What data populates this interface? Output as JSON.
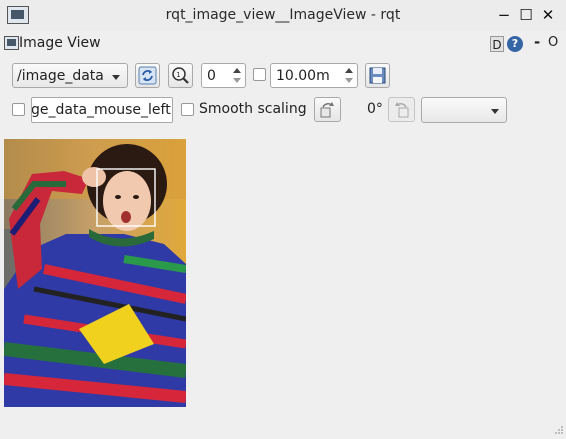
{
  "window": {
    "title": "rqt_image_view__ImageView - rqt",
    "minimize_glyph": "−",
    "maximize_glyph": "☐",
    "close_glyph": "✕"
  },
  "plugin": {
    "title": "Image View",
    "d_label": "D",
    "help_glyph": "?",
    "dash_label": "-",
    "o_label": "O"
  },
  "toolbar": {
    "topic_value": "/image_data",
    "zoom_value": "0",
    "duration_value": "10.00m",
    "mouse_topic_value": "ge_data_mouse_left",
    "smooth_scaling_label": "Smooth scaling",
    "rotation_value": "0°",
    "rotation_select_value": ""
  },
  "image": {
    "description_icon": "photo-frame",
    "face_box_color": "#ffffff"
  }
}
